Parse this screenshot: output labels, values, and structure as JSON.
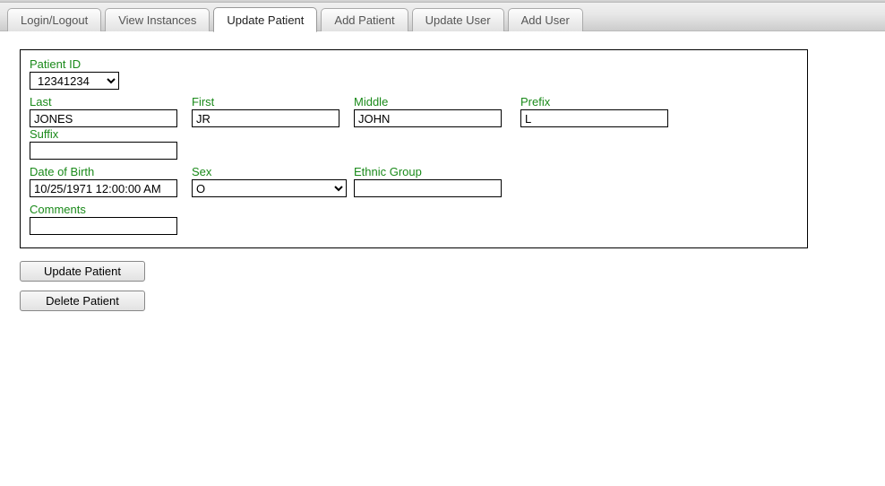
{
  "tabs": [
    {
      "label": "Login/Logout"
    },
    {
      "label": "View Instances"
    },
    {
      "label": "Update Patient",
      "active": true
    },
    {
      "label": "Add Patient"
    },
    {
      "label": "Update User"
    },
    {
      "label": "Add User"
    }
  ],
  "form": {
    "patient_id": {
      "label": "Patient ID",
      "value": "12341234"
    },
    "last": {
      "label": "Last",
      "value": "JONES"
    },
    "first": {
      "label": "First",
      "value": "JR"
    },
    "middle": {
      "label": "Middle",
      "value": "JOHN"
    },
    "prefix": {
      "label": "Prefix",
      "value": "L"
    },
    "suffix": {
      "label": "Suffix",
      "value": ""
    },
    "dob": {
      "label": "Date of Birth",
      "value": "10/25/1971 12:00:00 AM"
    },
    "sex": {
      "label": "Sex",
      "value": "O"
    },
    "ethnic": {
      "label": "Ethnic Group",
      "value": ""
    },
    "comments": {
      "label": "Comments",
      "value": ""
    }
  },
  "buttons": {
    "update": "Update Patient",
    "delete": "Delete Patient"
  }
}
